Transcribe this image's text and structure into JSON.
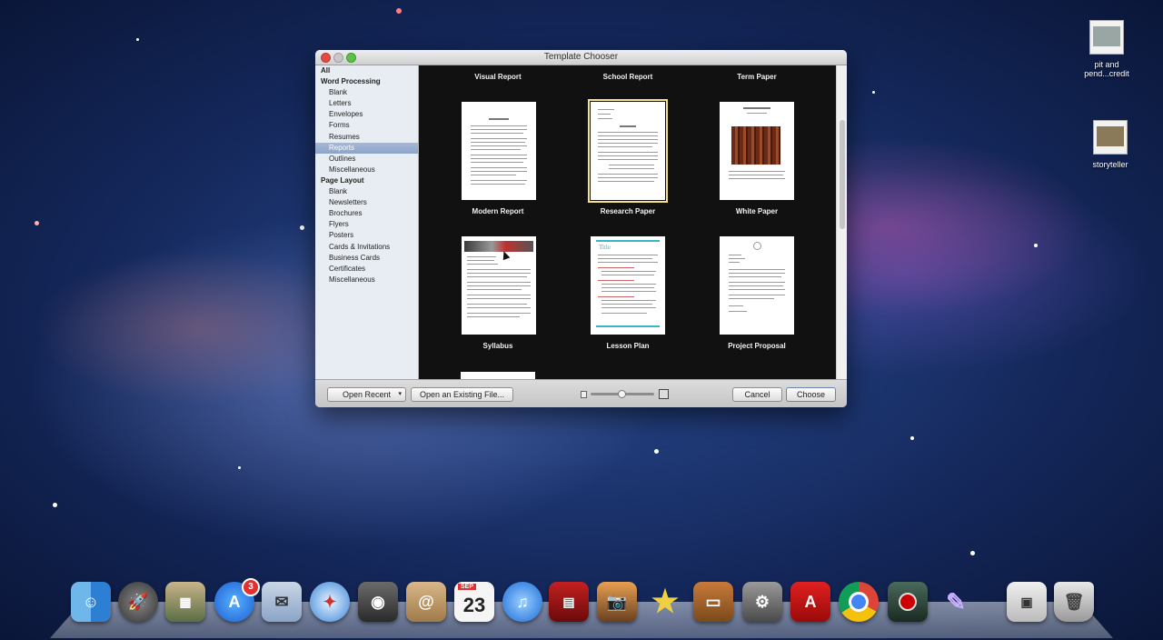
{
  "window": {
    "title": "Template Chooser"
  },
  "sidebar": {
    "items": [
      {
        "label": "All",
        "level": "top"
      },
      {
        "label": "Word Processing",
        "level": "top"
      },
      {
        "label": "Blank",
        "level": "sub"
      },
      {
        "label": "Letters",
        "level": "sub"
      },
      {
        "label": "Envelopes",
        "level": "sub"
      },
      {
        "label": "Forms",
        "level": "sub"
      },
      {
        "label": "Resumes",
        "level": "sub"
      },
      {
        "label": "Reports",
        "level": "sub",
        "selected": true
      },
      {
        "label": "Outlines",
        "level": "sub"
      },
      {
        "label": "Miscellaneous",
        "level": "sub"
      },
      {
        "label": "Page Layout",
        "level": "top"
      },
      {
        "label": "Blank",
        "level": "sub"
      },
      {
        "label": "Newsletters",
        "level": "sub"
      },
      {
        "label": "Brochures",
        "level": "sub"
      },
      {
        "label": "Flyers",
        "level": "sub"
      },
      {
        "label": "Posters",
        "level": "sub"
      },
      {
        "label": "Cards & Invitations",
        "level": "sub"
      },
      {
        "label": "Business Cards",
        "level": "sub"
      },
      {
        "label": "Certificates",
        "level": "sub"
      },
      {
        "label": "Miscellaneous",
        "level": "sub"
      }
    ]
  },
  "templates": {
    "top_row": [
      "Visual Report",
      "School Report",
      "Term Paper"
    ],
    "row1": [
      "Modern Report",
      "Research Paper",
      "White Paper"
    ],
    "row2": [
      "Syllabus",
      "Lesson Plan",
      "Project Proposal"
    ],
    "selected": "Research Paper",
    "lesson_plan_title": "Title"
  },
  "buttons": {
    "open_recent": "Open Recent",
    "open_existing": "Open an Existing File...",
    "cancel": "Cancel",
    "choose": "Choose"
  },
  "desktop": {
    "icons": [
      {
        "label_line1": "pit and",
        "label_line2": "pend...credit"
      },
      {
        "label_line1": "storyteller",
        "label_line2": ""
      }
    ]
  },
  "dock": {
    "app_store_badge": "3",
    "calendar_month": "SEP",
    "calendar_day": "23",
    "items": [
      "finder-icon",
      "launchpad-icon",
      "preview-icon",
      "app-store-icon",
      "mail-icon",
      "safari-icon",
      "facetime-icon",
      "address-book-icon",
      "calendar-icon",
      "itunes-icon",
      "photo-booth-icon",
      "iphoto-icon",
      "imovie-icon",
      "keynote-icon",
      "system-preferences-icon",
      "adobe-reader-icon",
      "chrome-icon",
      "screen-recorder-icon",
      "preview-tool-icon",
      "stack-icon",
      "trash-icon"
    ]
  }
}
